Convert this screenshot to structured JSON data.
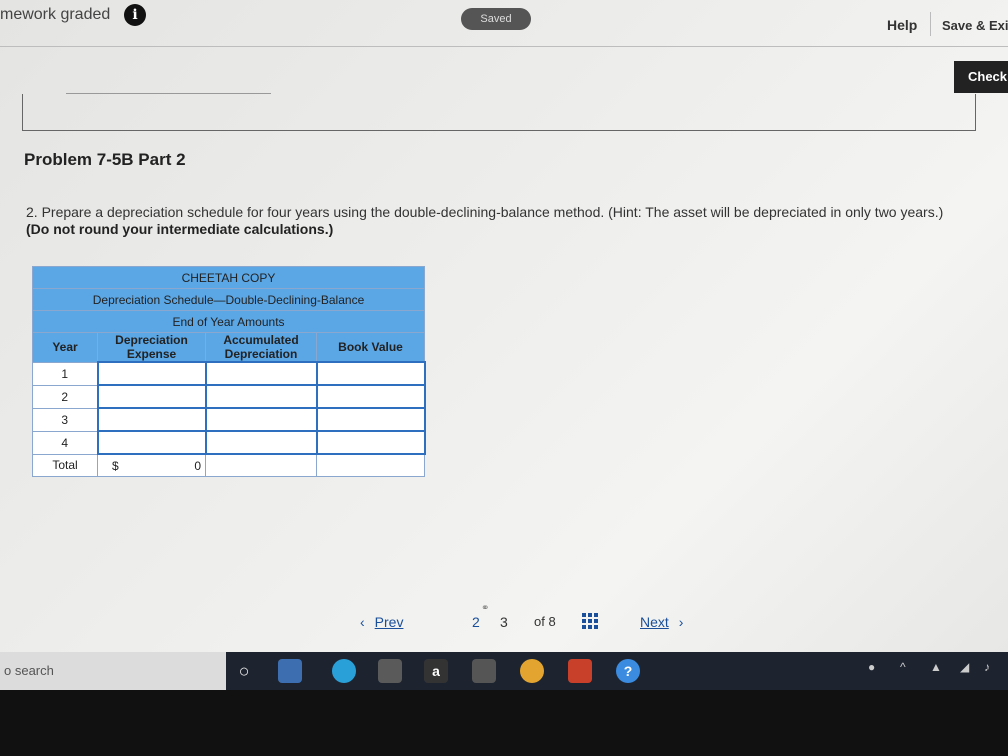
{
  "header": {
    "app_title": "mework graded",
    "info_glyph": "i",
    "saved_label": "Saved",
    "help_label": "Help",
    "save_exit_label": "Save & Exit"
  },
  "check_label": "Check",
  "problem": {
    "title": "Problem 7-5B Part 2",
    "instruction_main": "2. Prepare a depreciation schedule for four years using the double-declining-balance method. (Hint: The asset will be depreciated in only two years.)",
    "instruction_bold": "(Do not round your intermediate calculations.)"
  },
  "schedule": {
    "company": "CHEETAH COPY",
    "title": "Depreciation Schedule—Double-Declining-Balance",
    "subtitle": "End of Year Amounts",
    "headers": {
      "year": "Year",
      "dep_expense": "Depreciation Expense",
      "accum_dep": "Accumulated Depreciation",
      "book_value": "Book Value"
    },
    "years": [
      "1",
      "2",
      "3",
      "4"
    ],
    "total_label": "Total",
    "total_currency": "$",
    "total_value": "0"
  },
  "pagination": {
    "prev_label": "Prev",
    "pages": [
      "2",
      "3"
    ],
    "of_label": "of 8",
    "next_label": "Next"
  },
  "taskbar": {
    "search_placeholder": "o search"
  },
  "colors": {
    "table_header": "#5ba7e6",
    "input_border": "#2f6fc0",
    "link": "#1a4f9b"
  }
}
